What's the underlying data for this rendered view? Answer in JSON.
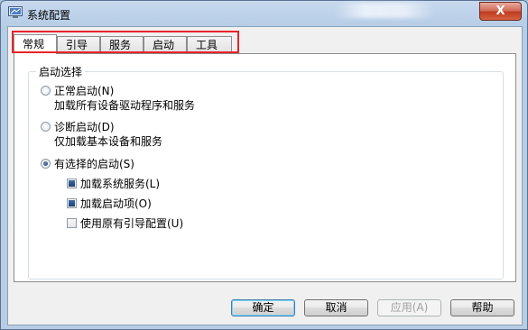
{
  "window": {
    "title": "系统配置",
    "close_label": "X"
  },
  "tabs": [
    {
      "label": "常规",
      "active": true
    },
    {
      "label": "引导",
      "active": false
    },
    {
      "label": "服务",
      "active": false
    },
    {
      "label": "启动",
      "active": false
    },
    {
      "label": "工具",
      "active": false
    }
  ],
  "startup_selection": {
    "legend": "启动选择",
    "options": [
      {
        "label": "正常启动(N)",
        "description": "加载所有设备驱动程序和服务",
        "checked": false
      },
      {
        "label": "诊断启动(D)",
        "description": "仅加载基本设备和服务",
        "checked": false
      },
      {
        "label": "有选择的启动(S)",
        "checked": true
      }
    ],
    "sub_options": [
      {
        "label": "加载系统服务(L)",
        "checked": true
      },
      {
        "label": "加载启动项(O)",
        "checked": true
      },
      {
        "label": "使用原有引导配置(U)",
        "checked": false
      }
    ]
  },
  "buttons": {
    "ok": "确定",
    "cancel": "取消",
    "apply": "应用(A)",
    "help": "帮助"
  },
  "colors": {
    "highlight_border": "#e8232b",
    "close_button": "#c03b22",
    "frame": "#b6cde6"
  }
}
